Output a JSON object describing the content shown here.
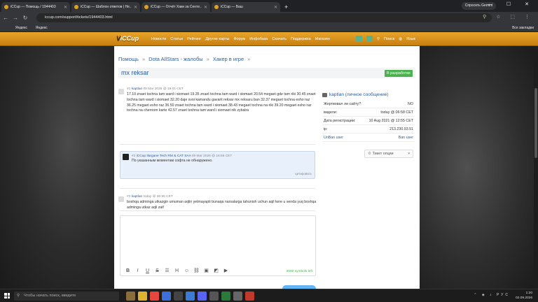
{
  "browser": {
    "tabs": [
      {
        "title": "iCCup — Помощь / 1944403",
        "active": true
      },
      {
        "title": "iCCup — Шаблон ответов | Не...",
        "active": false
      },
      {
        "title": "iCCup — Отчёт Хаки за Сенте...",
        "active": false
      },
      {
        "title": "iCCup — Ваш",
        "active": false
      }
    ],
    "new_tab": "+",
    "gemini_button": "Спросить Gemini",
    "window_controls": "— ☐ ✕",
    "url": "iccup.com/support/tickets/1944403.html",
    "bookmarks": [
      "Яндекс",
      "Яндекс"
    ],
    "all_bookmarks": "Все закладки"
  },
  "site_nav": {
    "logo_prefix": "V",
    "logo": "iCCup",
    "links": [
      "Новости",
      "Статьи",
      "Рейтинг",
      "Другие карты",
      "Форум",
      "Инфобаза",
      "Скачать",
      "Поддержка",
      "Магазин"
    ],
    "search": "Поиск",
    "language": "Язык"
  },
  "breadcrumb": {
    "items": [
      "Помощь",
      "Dota AllStars - жалобы",
      "Хакер в игре"
    ],
    "separator": "»"
  },
  "ticket": {
    "title": "mx reksar",
    "status": "В разработке"
  },
  "posts": [
    {
      "num": "#1",
      "author": "kaptlan",
      "time": "09 Mar 2026 @ 19:01 CET",
      "body": "17.10 znaet tochna tam ward i siomaet 19.35 znaet tochna tam ward i siomaet 20.54 megaet gde tam riki 30.45 znaet tochna tam ward i siomaet 32.20 daje svoi kamandu gavarit reksar mx reksaru ban 32.37 megaet tochna esho raz 36.25 megaet esho raz 36.50 znaet tochna tam ward i siomaet 38.43 megaet tochna na riki 39.20 megaet esho raz tochna na chernom karte 42.57 znaet tochna tam ward i siomaet nik zybalra"
    },
    {
      "num": "#2",
      "author": "iCCup Ilargane Tech RM & CAT SAA",
      "time": "09 Mar 2026 @ 16:56 CET",
      "body": "По указанным моментам софта не обнаружено.",
      "quote": "цитировать"
    },
    {
      "num": "#3",
      "author": "kaptlan",
      "time": "today @ 06:56 CET",
      "body": "boshqa adminga utkazgin umuman aqlin yetmayapti bunaqa narsalarga tahunish uchun aqil kere u senda yuq boshqa adminga utkaz aqli zaif"
    }
  ],
  "side_panel": {
    "heading": "kaptlan (личное сообщение)",
    "rows": [
      {
        "key": "Жертвовал ли сайту?:",
        "value": "NO"
      },
      {
        "key": "видели:",
        "value": "today @ 06:58 CET"
      },
      {
        "key": "Дата регистрации:",
        "value": "10 Aug 2021 @ 12:55 CET"
      },
      {
        "key": "ip:",
        "value": "213.230.93.51"
      },
      {
        "key": "UnBan user",
        "value": "Ban user"
      }
    ],
    "ticket_options": "Тикет опции"
  },
  "editor": {
    "toolbar_icons": [
      "bold-icon",
      "italic-icon",
      "underline-icon",
      "strikethrough-icon",
      "list-icon",
      "heading-icon",
      "emoji-icon",
      "link-icon",
      "image-icon",
      "spoiler-icon",
      "video-icon"
    ],
    "toolbar_glyphs": [
      "B",
      "I",
      "U",
      "S",
      "☰",
      "H",
      "☺",
      "⛓",
      "▣",
      "◩",
      "▶"
    ],
    "counter": "3000 symbols left"
  },
  "taskbar": {
    "search_placeholder": "Чтобы начать поиск, введите",
    "time": "1:20",
    "date": "02.09.2026",
    "language": "РУС"
  }
}
